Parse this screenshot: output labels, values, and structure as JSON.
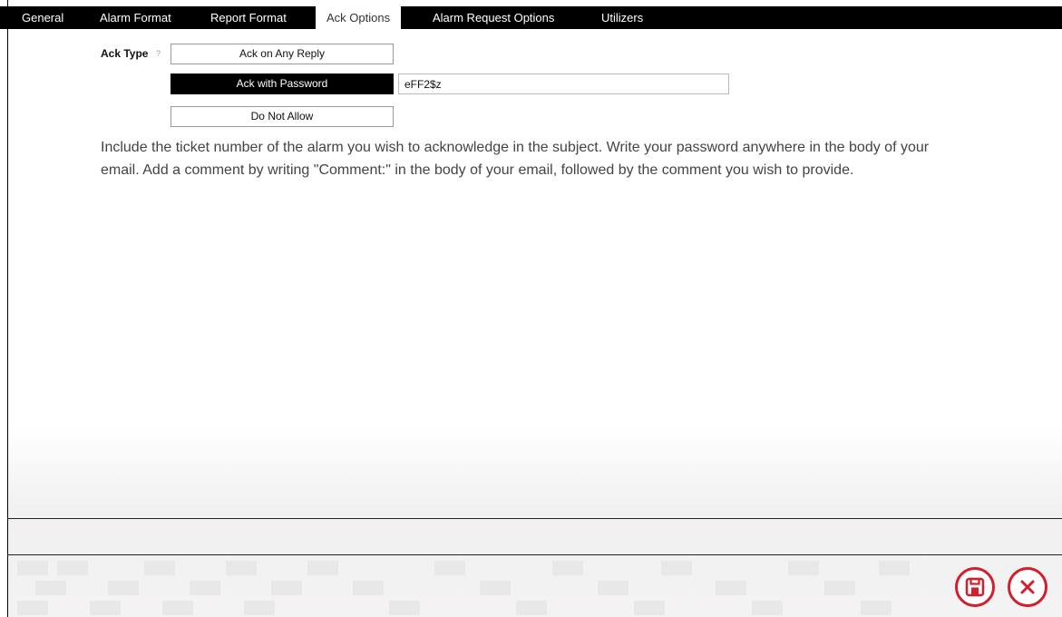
{
  "tabs": [
    {
      "label": "General"
    },
    {
      "label": "Alarm Format"
    },
    {
      "label": "Report Format"
    },
    {
      "label": "Ack Options",
      "active": true
    },
    {
      "label": "Alarm Request Options"
    },
    {
      "label": "Utilizers"
    }
  ],
  "ack": {
    "label": "Ack Type",
    "help_glyph": "?",
    "options": [
      {
        "label": "Ack on Any Reply",
        "selected": false
      },
      {
        "label": "Ack with Password",
        "selected": true
      },
      {
        "label": "Do Not Allow",
        "selected": false
      }
    ],
    "password_value": "eFF2$z"
  },
  "description": "Include the ticket number of the alarm you wish to acknowledge in the subject. Write your password anywhere in the body of your email. Add a comment by writing \"Comment:\" in the body of your email, followed by the comment you wish to provide.",
  "actions": {
    "save_icon": "floppy-disk-icon",
    "close_icon": "close-x-icon",
    "accent_color": "#d21f2c"
  }
}
